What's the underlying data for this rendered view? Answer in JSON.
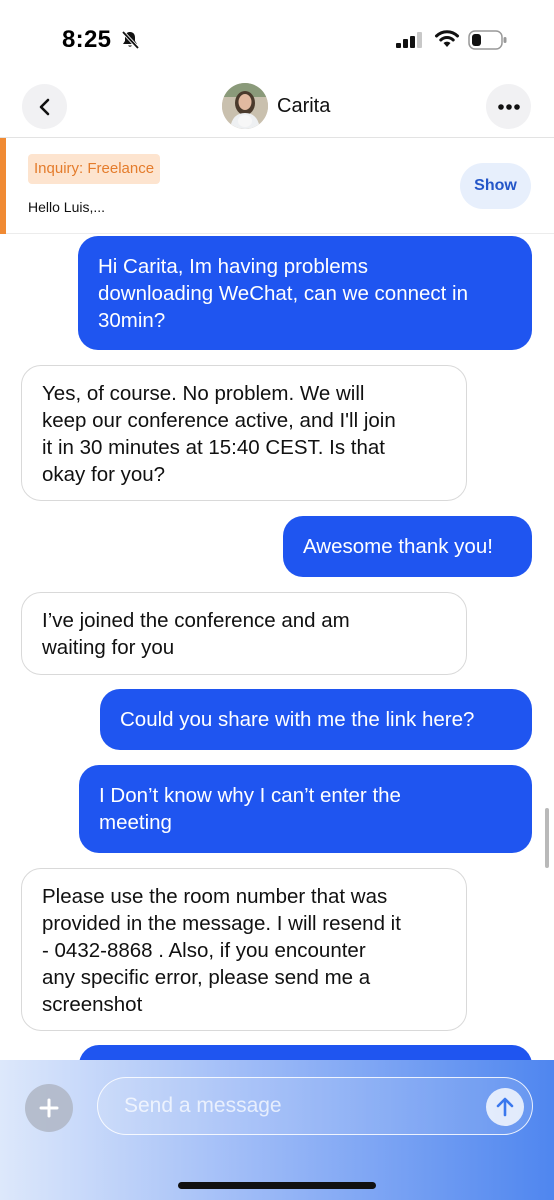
{
  "status_bar": {
    "time": "8:25",
    "icons": [
      "bell-slash-icon",
      "cellular-signal-icon",
      "wifi-icon",
      "battery-icon"
    ]
  },
  "header": {
    "contact_name": "Carita",
    "back_icon": "chevron-left-icon",
    "more_icon": "more-horizontal-icon"
  },
  "inquiry": {
    "tag": "Inquiry: Freelance",
    "preview": "Hello Luis,...",
    "show_label": "Show",
    "accent_color": "#f08a33"
  },
  "messages": [
    {
      "direction": "out",
      "lines": [
        "Hi Carita, Im having problems",
        "downloading WeChat, can we connect in",
        "30min?"
      ]
    },
    {
      "direction": "in",
      "lines": [
        "Yes, of course. No problem. We will",
        "keep our conference active, and I'll join",
        "it in 30 minutes at 15:40 CEST. Is that",
        "okay for you?"
      ]
    },
    {
      "direction": "out",
      "lines": [
        "Awesome thank you!"
      ]
    },
    {
      "direction": "in",
      "lines": [
        "I’ve joined the conference and am",
        "waiting for you"
      ]
    },
    {
      "direction": "out",
      "lines": [
        "Could you share with me the link here?"
      ]
    },
    {
      "direction": "out",
      "lines": [
        "I Don’t know why I can’t enter the",
        "meeting"
      ]
    },
    {
      "direction": "in",
      "lines": [
        "Please use the room number that was",
        "provided in the message. I will resend it",
        "- 0432-8868 . Also, if you encounter",
        "any specific error, please send me a",
        "screenshot"
      ]
    },
    {
      "direction": "out",
      "lines": [
        ""
      ]
    }
  ],
  "composer": {
    "placeholder": "Send a message",
    "value": ""
  },
  "colors": {
    "outgoing_bubble": "#1f55f0",
    "incoming_bubble": "#ffffff",
    "link_blue": "#2456c8"
  }
}
